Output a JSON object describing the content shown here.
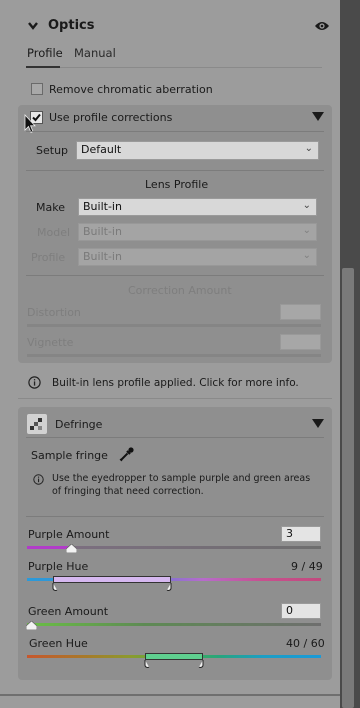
{
  "header": {
    "title": "Optics"
  },
  "tabs": [
    {
      "label": "Profile"
    },
    {
      "label": "Manual"
    }
  ],
  "chromatic": {
    "label": "Remove chromatic aberration",
    "checked": false
  },
  "profile_corrections": {
    "label": "Use profile corrections",
    "checked": true,
    "setup": {
      "label": "Setup",
      "value": "Default"
    },
    "lens_profile_heading": "Lens Profile",
    "make": {
      "label": "Make",
      "value": "Built-in"
    },
    "model": {
      "label": "Model",
      "value": "Built-in"
    },
    "profile": {
      "label": "Profile",
      "value": "Built-in"
    },
    "correction_heading": "Correction Amount",
    "distortion": {
      "label": "Distortion"
    },
    "vignette": {
      "label": "Vignette"
    }
  },
  "info": {
    "text": "Built-in lens profile applied.  Click for more info."
  },
  "defringe": {
    "title": "Defringe",
    "sample_label": "Sample fringe",
    "note": "Use the eyedropper to sample purple and green areas of fringing that need correction.",
    "purple_amount": {
      "label": "Purple Amount",
      "value": "3",
      "fraction": 0.15
    },
    "purple_hue": {
      "label": "Purple Hue",
      "value": "9 / 49",
      "low": 9,
      "high": 49,
      "max": 100
    },
    "green_amount": {
      "label": "Green Amount",
      "value": "0",
      "fraction": 0
    },
    "green_hue": {
      "label": "Green Hue",
      "value": "40 / 60",
      "low": 40,
      "high": 60,
      "max": 100
    }
  },
  "colors": {
    "accent_purple": "#b13cc8",
    "accent_green": "#5db248",
    "section_bg": "#8f8f8f",
    "panel_bg": "#9c9c9c"
  },
  "icons": [
    "chevron-down-icon",
    "eye-icon",
    "checkbox",
    "triangle-down-icon",
    "info-icon",
    "defringe-icon",
    "eyedropper-icon",
    "mouse-cursor"
  ]
}
